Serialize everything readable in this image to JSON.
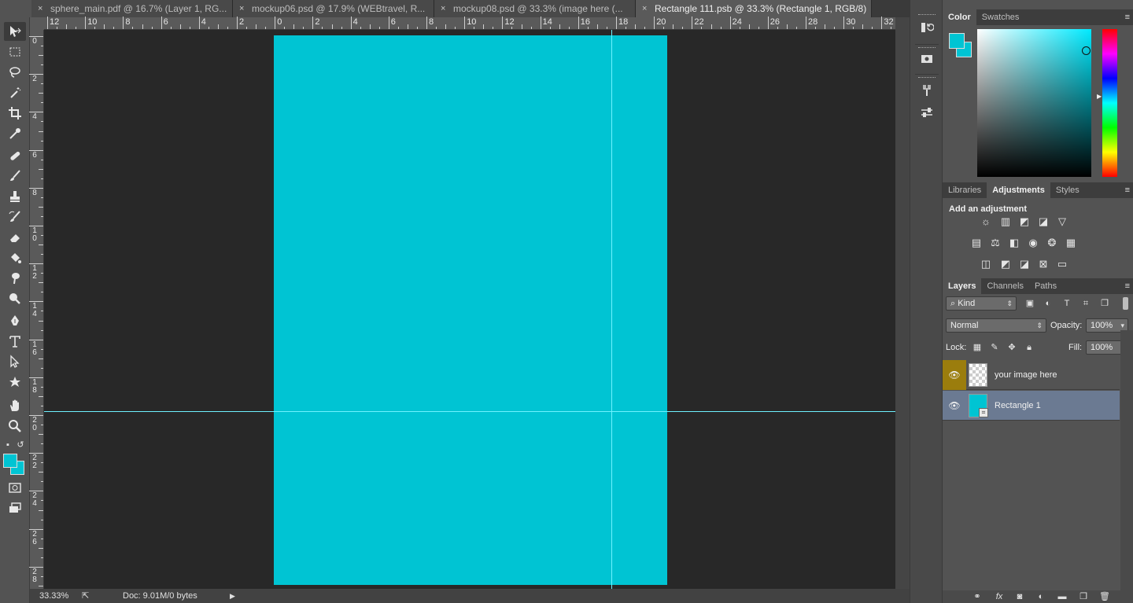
{
  "tabs": [
    {
      "label": "sphere_main.pdf @ 16.7% (Layer 1, RG...",
      "active": false
    },
    {
      "label": "mockup06.psd @ 17.9% (WEBtravel, R...",
      "active": false
    },
    {
      "label": "mockup08.psd @ 33.3% (image here (...",
      "active": false
    },
    {
      "label": "Rectangle 111.psb @ 33.3% (Rectangle 1, RGB/8)",
      "active": true
    }
  ],
  "tab_close_glyph": "×",
  "ruler_top_labels": [
    "12",
    "10",
    "8",
    "6",
    "4",
    "2",
    "0",
    "2",
    "4",
    "6",
    "8",
    "10",
    "12",
    "14",
    "16",
    "18",
    "20",
    "22",
    "24",
    "26",
    "28",
    "30",
    "32"
  ],
  "ruler_left_labels": [
    "0",
    "2",
    "4",
    "6",
    "8",
    "1\n0",
    "1\n2",
    "1\n4",
    "1\n6",
    "1\n8",
    "2\n0",
    "2\n2",
    "2\n4",
    "2\n6",
    "2\n8"
  ],
  "colors": {
    "foreground": "#00c4d3",
    "background": "#00c4d3",
    "artboard": "#00c4d3",
    "guide": "#6ef2ff",
    "hue_marker": "#00c4d3"
  },
  "status": {
    "zoom": "33.33%",
    "doc": "Doc: 9.01M/0 bytes"
  },
  "color_panel": {
    "tabs": [
      "Color",
      "Swatches"
    ],
    "active": "Color"
  },
  "adjustments_panel": {
    "tabs": [
      "Libraries",
      "Adjustments",
      "Styles"
    ],
    "active": "Adjustments",
    "title": "Add an adjustment"
  },
  "layers_panel": {
    "tabs": [
      "Layers",
      "Channels",
      "Paths"
    ],
    "active": "Layers",
    "filter": "Kind",
    "blend_mode": "Normal",
    "opacity_label": "Opacity:",
    "opacity": "100%",
    "lock_label": "Lock:",
    "fill_label": "Fill:",
    "fill": "100%",
    "layers": [
      {
        "name": "your image here",
        "visible": true,
        "selected": false
      },
      {
        "name": "Rectangle 1",
        "visible": true,
        "selected": true
      }
    ]
  },
  "icons": {
    "eye": "👁",
    "menu": "≡",
    "arrows": "⇕",
    "dropdown": "▾"
  }
}
